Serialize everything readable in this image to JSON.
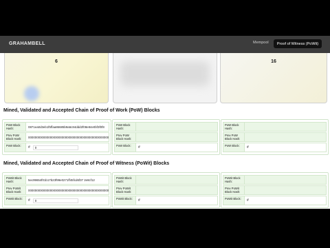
{
  "navbar": {
    "brand": "GRAHAMBELL",
    "mempool_label": "Mempool",
    "pow_button_label": "Proof of Witness (PoWit)"
  },
  "cards": [
    {
      "number": "6"
    },
    {
      "number": ""
    },
    {
      "number": "16"
    }
  ],
  "pow_section": {
    "title": "Mined, Validated and Accepted Chain of Proof of Work (PoW) Blocks",
    "blocks": [
      {
        "hash_label": "PoW Block Hash:",
        "hash_value": "0871ea0d3eb1f5ffaa86685b9a5c84ddd2f08e84e0bf3f0f8",
        "prev_label": "Prev PoW Block Hash:",
        "prev_value": "0000000000000000000000000000000000000000000000000",
        "block_label": "PoW Block:",
        "block_hash_sign": "#",
        "block_value": "0"
      },
      {
        "hash_label": "PoW Block Hash:",
        "hash_value": "",
        "prev_label": "Prev PoW Block Hash:",
        "prev_value": "",
        "block_label": "PoW Block:",
        "block_hash_sign": "#",
        "block_value": ""
      },
      {
        "hash_label": "PoW Block Hash:",
        "hash_value": "",
        "prev_label": "Prev PoW Block Hash:",
        "prev_value": "",
        "block_label": "PoW Block:",
        "block_hash_sign": "#",
        "block_value": ""
      }
    ]
  },
  "powit_section": {
    "title": "Mined, Validated and Accepted Chain of Proof of Witness (PoWit) Blocks",
    "blocks": [
      {
        "hash_label": "PoWit Block Hash:",
        "hash_value": "5ec99654f01b17b23f99e0271ff45fcd6f37 2e8cf12",
        "prev_label": "Prev PoWit Block Hash:",
        "prev_value": "0000000000000000000000000000000000000000000000000",
        "block_label": "PoWit Block:",
        "block_hash_sign": "#",
        "block_value": "0"
      },
      {
        "hash_label": "PoWit Block Hash:",
        "hash_value": "",
        "prev_label": "Prev PoWit Block Hash:",
        "prev_value": "",
        "block_label": "PoWit Block:",
        "block_hash_sign": "#",
        "block_value": ""
      },
      {
        "hash_label": "PoWit Block Hash:",
        "hash_value": "",
        "prev_label": "Prev PoWit Block Hash:",
        "prev_value": "",
        "block_label": "PoWit Block:",
        "block_hash_sign": "#",
        "block_value": ""
      }
    ]
  }
}
